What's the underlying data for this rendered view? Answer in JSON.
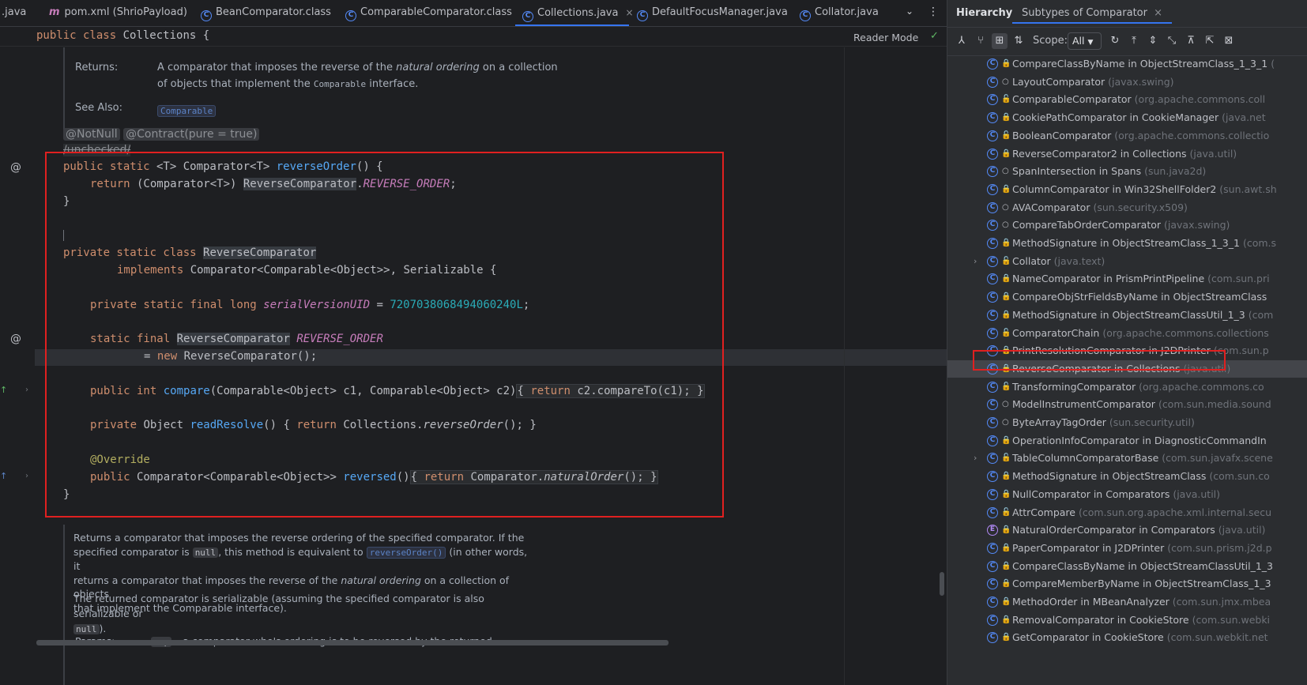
{
  "tabs": [
    {
      "label": ".java",
      "icon": "none"
    },
    {
      "label": "pom.xml (ShrioPayload)",
      "icon": "maven-icon"
    },
    {
      "label": "BeanComparator.class",
      "icon": "class-icon"
    },
    {
      "label": "ComparableComparator.class",
      "icon": "class-icon"
    },
    {
      "label": "Collections.java",
      "icon": "class-icon",
      "active": true,
      "close": "×"
    },
    {
      "label": "DefaultFocusManager.java",
      "icon": "class-icon"
    },
    {
      "label": "Collator.java",
      "icon": "class-icon"
    }
  ],
  "breadcrumb": {
    "text": "public class Collections {",
    "reader_mode": "Reader Mode"
  },
  "doc_top": {
    "returns_label": "Returns:",
    "returns_text_1": "A comparator that imposes the reverse of the",
    "returns_italic": "natural ordering",
    "returns_text_2": "on a collection",
    "returns_text_3": "of objects that implement the",
    "returns_code": "Comparable",
    "returns_text_4": "interface.",
    "see_also_label": "See Also:",
    "see_also_link": "Comparable"
  },
  "annotations": {
    "not_null": "@NotNull",
    "contract": "@Contract(pure = true)",
    "unchecked": "/unchecked/"
  },
  "code": {
    "l1_kw": "public static",
    "l1_mid": " <T> Comparator<T> ",
    "l1_fn": "reverseOrder",
    "l1_end": "() {",
    "l2_kw": "return",
    "l2_mid": " (Comparator<T>) ",
    "l2_sel": "ReverseComparator",
    "l2_dot": ".",
    "l2_it": "REVERSE_ORDER",
    "l2_end": ";",
    "l3": "}",
    "l4_kw": "private static class",
    "l4_sel": "ReverseComparator",
    "l5_kw": "implements",
    "l5_end": " Comparator<Comparable<Object>>, Serializable {",
    "l6_kw": "private static final long",
    "l6_it": "serialVersionUID",
    "l6_eq": " = ",
    "l6_num": "7207038068494060240L",
    "l6_end": ";",
    "l7_kw": "static final",
    "l7_sel": "ReverseComparator",
    "l7_it": "REVERSE_ORDER",
    "l8_eq": "= ",
    "l8_kw": "new",
    "l8_end": "ReverseComparator();",
    "l9_kw": "public int",
    "l9_fn": "compare",
    "l9_mid": "(Comparable<Object> c1, Comparable<Object> c2)",
    "l9_fold_kw": "return",
    "l9_fold": " c2.compareTo(c1);",
    "l10_kw": "private",
    "l10_mid": " Object ",
    "l10_fn": "readResolve",
    "l10_a": "() { ",
    "l10_kw2": "return",
    "l10_b": " Collections.",
    "l10_it": "reverseOrder",
    "l10_c": "(); }",
    "l11_ann": "@Override",
    "l12_kw": "public",
    "l12_mid": " Comparator<Comparable<Object>> ",
    "l12_fn": "reversed",
    "l12_a": "()",
    "l12_kw2": "return",
    "l12_b": " Comparator.",
    "l12_it": "naturalOrder",
    "l12_c": "();",
    "l13": "}"
  },
  "doc_bottom": {
    "p1_a": "Returns a comparator that imposes the reverse ordering of the specified comparator. If the",
    "p1_b": "specified comparator is",
    "p1_null": "null",
    "p1_c": ", this method is equivalent to",
    "p1_link": "reverseOrder()",
    "p1_d": "(in other words, it",
    "p1_e": "returns a comparator that imposes the reverse of the",
    "p1_it": "natural ordering",
    "p1_f": "on a collection of objects",
    "p1_g": "that implement the Comparable interface).",
    "p2_a": "The returned comparator is serializable (assuming the specified comparator is also serializable or",
    "p2_null": "null",
    "p2_b": ").",
    "params_label": "Params:",
    "params_code": "cmp",
    "params_text": "– a comparator who's ordering is to be reversed by the returned"
  },
  "panel": {
    "tab_hierarchy": "Hierarchy",
    "tab_subtypes": "Subtypes of Comparator",
    "close": "×",
    "scope_label": "Scope:",
    "scope_value": "All",
    "items": [
      {
        "name": "CompareClassByName in ObjectStreamClass_1_3_1",
        "pkg": "(",
        "mod": "lock"
      },
      {
        "name": "LayoutComparator",
        "pkg": "(javax.swing)",
        "mod": "dot"
      },
      {
        "name": "ComparableComparator",
        "pkg": "(org.apache.commons.coll",
        "mod": "open"
      },
      {
        "name": "CookiePathComparator in CookieManager",
        "pkg": "(java.net",
        "mod": "lock"
      },
      {
        "name": "BooleanComparator",
        "pkg": "(org.apache.commons.collectio",
        "mod": "open"
      },
      {
        "name": "ReverseComparator2 in Collections",
        "pkg": "(java.util)",
        "mod": "lock"
      },
      {
        "name": "SpanIntersection in Spans",
        "pkg": "(sun.java2d)",
        "mod": "dot"
      },
      {
        "name": "ColumnComparator in Win32ShellFolder2",
        "pkg": "(sun.awt.sh",
        "mod": "lock"
      },
      {
        "name": "AVAComparator",
        "pkg": "(sun.security.x509)",
        "mod": "dot"
      },
      {
        "name": "CompareTabOrderComparator",
        "pkg": "(javax.swing)",
        "mod": "dot"
      },
      {
        "name": "MethodSignature in ObjectStreamClass_1_3_1",
        "pkg": "(com.s",
        "mod": "lock"
      },
      {
        "name": "Collator",
        "pkg": "(java.text)",
        "mod": "open",
        "expand": true
      },
      {
        "name": "NameComparator in PrismPrintPipeline",
        "pkg": "(com.sun.pri",
        "mod": "lock"
      },
      {
        "name": "CompareObjStrFieldsByName in ObjectStreamClass",
        "pkg": "",
        "mod": "lock"
      },
      {
        "name": "MethodSignature in ObjectStreamClassUtil_1_3",
        "pkg": "(com",
        "mod": "lock"
      },
      {
        "name": "ComparatorChain",
        "pkg": "(org.apache.commons.collections",
        "mod": "open"
      },
      {
        "name": "PrintResolutionComparator in J2DPrinter",
        "pkg": "(com.sun.p",
        "mod": "lock"
      },
      {
        "name": "ReverseComparator in Collections",
        "pkg": "(java.util)",
        "mod": "lock",
        "selected": true
      },
      {
        "name": "TransformingComparator",
        "pkg": "(org.apache.commons.co",
        "mod": "open"
      },
      {
        "name": "ModelInstrumentComparator",
        "pkg": "(com.sun.media.sound",
        "mod": "dot"
      },
      {
        "name": "ByteArrayTagOrder",
        "pkg": "(sun.security.util)",
        "mod": "dot"
      },
      {
        "name": "OperationInfoComparator in DiagnosticCommandIn",
        "pkg": "",
        "mod": "lock"
      },
      {
        "name": "TableColumnComparatorBase",
        "pkg": "(com.sun.javafx.scene",
        "mod": "open",
        "expand": true
      },
      {
        "name": "MethodSignature in ObjectStreamClass",
        "pkg": "(com.sun.co",
        "mod": "lock"
      },
      {
        "name": "NullComparator in Comparators",
        "pkg": "(java.util)",
        "mod": "lock"
      },
      {
        "name": "AttrCompare",
        "pkg": "(com.sun.org.apache.xml.internal.secu",
        "mod": "open"
      },
      {
        "name": "NaturalOrderComparator in Comparators",
        "pkg": "(java.util)",
        "mod": "lock",
        "kind": "enum"
      },
      {
        "name": "PaperComparator in J2DPrinter",
        "pkg": "(com.sun.prism.j2d.p",
        "mod": "lock"
      },
      {
        "name": "CompareClassByName in ObjectStreamClassUtil_1_3",
        "pkg": "",
        "mod": "lock"
      },
      {
        "name": "CompareMemberByName in ObjectStreamClass_1_3",
        "pkg": "",
        "mod": "lock"
      },
      {
        "name": "MethodOrder in MBeanAnalyzer",
        "pkg": "(com.sun.jmx.mbea",
        "mod": "lock"
      },
      {
        "name": "RemovalComparator in CookieStore",
        "pkg": "(com.sun.webki",
        "mod": "lock"
      },
      {
        "name": "GetComparator in CookieStore",
        "pkg": "(com.sun.webkit.net",
        "mod": "lock"
      }
    ]
  }
}
